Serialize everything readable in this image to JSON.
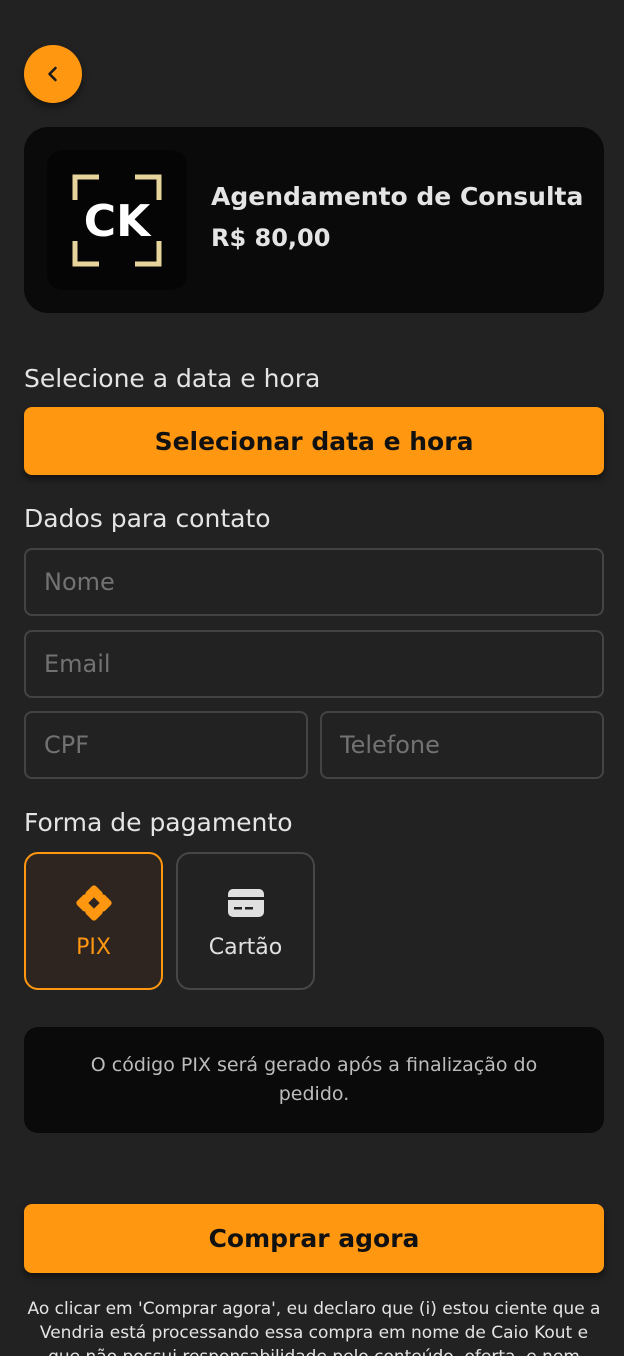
{
  "product": {
    "logo_text": "CK",
    "title": "Agendamento de Consulta",
    "price": "R$ 80,00"
  },
  "schedule": {
    "label": "Selecione a data e hora",
    "button_label": "Selecionar data e hora"
  },
  "contact": {
    "label": "Dados para contato",
    "name_placeholder": "Nome",
    "email_placeholder": "Email",
    "cpf_placeholder": "CPF",
    "phone_placeholder": "Telefone"
  },
  "payment": {
    "label": "Forma de pagamento",
    "options": [
      {
        "label": "PIX",
        "icon": "pix-icon",
        "selected": true
      },
      {
        "label": "Cartão",
        "icon": "credit-card-icon",
        "selected": false
      }
    ],
    "info_text": "O código PIX será gerado após a finalização do pedido."
  },
  "checkout": {
    "buy_label": "Comprar agora",
    "disclaimer": "Ao clicar em 'Comprar agora', eu declaro que (i) estou ciente que a Vendria está processando essa compra em nome de Caio Kout e que não possui responsabilidade pelo conteúdo, oferta, e nem"
  },
  "colors": {
    "accent": "#ff9711",
    "background": "#232222",
    "card": "#0a0a0a",
    "logo_gold": "#e6d49c"
  }
}
